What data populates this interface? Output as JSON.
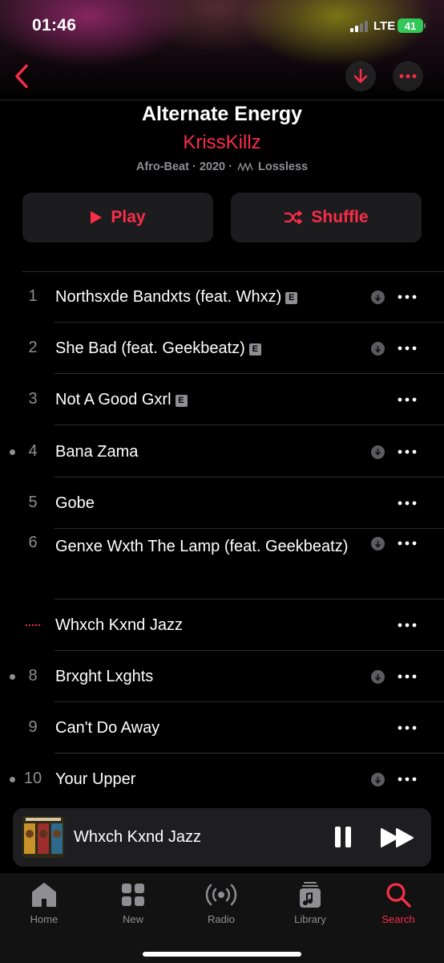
{
  "status_bar": {
    "time": "01:46",
    "network": "LTE",
    "battery": "41"
  },
  "album": {
    "title": "Alternate Energy",
    "artist": "KrissKillz",
    "genre_year": "Afro-Beat · 2020 ·",
    "quality": "Lossless"
  },
  "actions": {
    "play_label": "Play",
    "shuffle_label": "Shuffle"
  },
  "tracks": [
    {
      "number": "1",
      "title": "Northsxde Bandxts (feat. Whxz)",
      "explicit": "E",
      "downloaded": true,
      "dot": false
    },
    {
      "number": "2",
      "title": "She Bad (feat. Geekbeatz)",
      "explicit": "E",
      "downloaded": true,
      "dot": false
    },
    {
      "number": "3",
      "title": "Not A Good Gxrl",
      "explicit": "E",
      "downloaded": false,
      "dot": false
    },
    {
      "number": "4",
      "title": "Bana Zama",
      "explicit": "",
      "downloaded": true,
      "dot": true
    },
    {
      "number": "5",
      "title": "Gobe",
      "explicit": "",
      "downloaded": false,
      "dot": false
    },
    {
      "number": "6",
      "title": "Genxe Wxth The Lamp (feat. Geekbeatz)",
      "explicit": "",
      "downloaded": true,
      "dot": false
    },
    {
      "number": "",
      "title": "Whxch Kxnd Jazz",
      "explicit": "",
      "downloaded": false,
      "dot": false,
      "now_playing": true
    },
    {
      "number": "8",
      "title": "Brxght Lxghts",
      "explicit": "",
      "downloaded": true,
      "dot": true
    },
    {
      "number": "9",
      "title": "Can't Do Away",
      "explicit": "",
      "downloaded": false,
      "dot": false
    },
    {
      "number": "10",
      "title": "Your Upper",
      "explicit": "",
      "downloaded": true,
      "dot": true
    }
  ],
  "mini_player": {
    "title": "Whxch Kxnd Jazz"
  },
  "tabs": [
    {
      "label": "Home",
      "icon": "home-icon",
      "active": false
    },
    {
      "label": "New",
      "icon": "grid-icon",
      "active": false
    },
    {
      "label": "Radio",
      "icon": "radio-icon",
      "active": false
    },
    {
      "label": "Library",
      "icon": "library-icon",
      "active": false
    },
    {
      "label": "Search",
      "icon": "search-icon",
      "active": true
    }
  ],
  "colors": {
    "accent": "#fa2d48",
    "secondary": "#8e8e93",
    "battery": "#34c759"
  }
}
